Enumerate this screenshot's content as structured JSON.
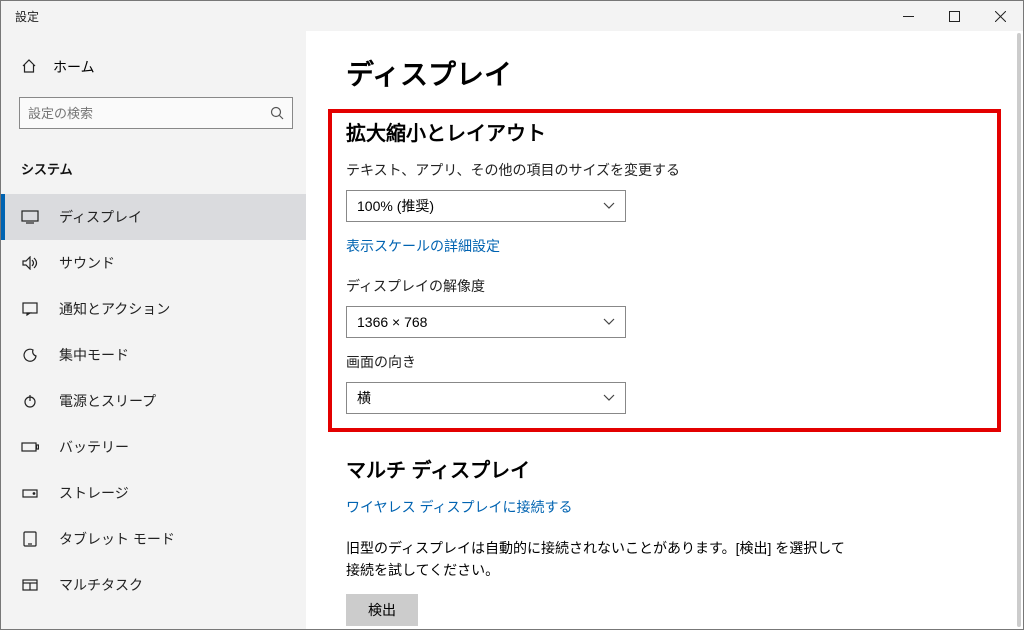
{
  "window": {
    "title": "設定"
  },
  "sidebar": {
    "home": "ホーム",
    "search_placeholder": "設定の検索",
    "category": "システム",
    "items": [
      {
        "label": "ディスプレイ"
      },
      {
        "label": "サウンド"
      },
      {
        "label": "通知とアクション"
      },
      {
        "label": "集中モード"
      },
      {
        "label": "電源とスリープ"
      },
      {
        "label": "バッテリー"
      },
      {
        "label": "ストレージ"
      },
      {
        "label": "タブレット モード"
      },
      {
        "label": "マルチタスク"
      }
    ]
  },
  "main": {
    "title": "ディスプレイ",
    "scaling": {
      "heading": "拡大縮小とレイアウト",
      "scale_label": "テキスト、アプリ、その他の項目のサイズを変更する",
      "scale_value": "100% (推奨)",
      "advanced_link": "表示スケールの詳細設定",
      "resolution_label": "ディスプレイの解像度",
      "resolution_value": "1366 × 768",
      "orientation_label": "画面の向き",
      "orientation_value": "横"
    },
    "multi": {
      "heading": "マルチ ディスプレイ",
      "wireless_link": "ワイヤレス ディスプレイに接続する",
      "desc": "旧型のディスプレイは自動的に接続されないことがあります。[検出] を選択して接続を試してください。",
      "detect_btn": "検出"
    }
  }
}
